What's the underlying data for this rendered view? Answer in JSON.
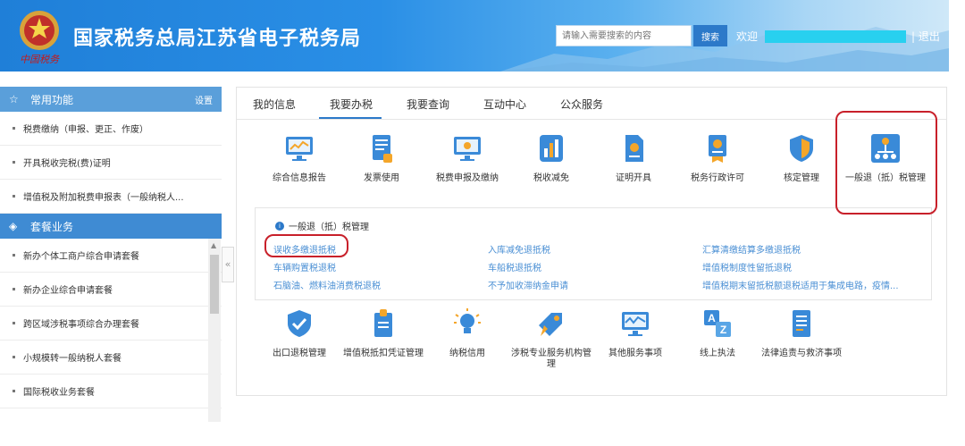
{
  "header": {
    "site_title": "国家税务总局江苏省电子税务局",
    "signature": "中国税务",
    "search_placeholder": "请输入需要搜索的内容",
    "search_label": "搜索",
    "welcome": "欢迎",
    "logout": "| 退出"
  },
  "sidebar": {
    "common_title": "常用功能",
    "settings": "设置",
    "common_items": [
      "税费缴纳（申报、更正、作废）",
      "开具税收完税(费)证明",
      "增值税及附加税费申报表（一般纳税人..."
    ],
    "package_title": "套餐业务",
    "package_items": [
      "新办个体工商户综合申请套餐",
      "新办企业综合申请套餐",
      "跨区域涉税事项综合办理套餐",
      "小规模转一般纳税人套餐",
      "国际税收业务套餐"
    ],
    "collapse": "«"
  },
  "tabs": [
    "我的信息",
    "我要办税",
    "我要查询",
    "互动中心",
    "公众服务"
  ],
  "tiles_row1": [
    {
      "label": "综合信息报告",
      "icon": "monitor-chart-icon"
    },
    {
      "label": "发票使用",
      "icon": "document-icon"
    },
    {
      "label": "税费申报及缴纳",
      "icon": "screen-icon"
    },
    {
      "label": "税收减免",
      "icon": "bar-chart-icon"
    },
    {
      "label": "证明开具",
      "icon": "certificate-icon"
    },
    {
      "label": "税务行政许可",
      "icon": "award-icon"
    },
    {
      "label": "核定管理",
      "icon": "shield-icon"
    },
    {
      "label": "一般退（抵）税管理",
      "icon": "person-network-icon"
    }
  ],
  "sub_panel": {
    "title": "一般退（抵）税管理",
    "links": [
      "误收多缴退抵税",
      "入库减免退抵税",
      "汇算清缴结算多缴退抵税",
      "车辆购置税退税",
      "车船税退抵税",
      "增值税制度性留抵退税",
      "石脑油、燃料油消费税退税",
      "不予加收滞纳金申请",
      "增值税期末留抵税额退税适用于集成电路，疫情..."
    ]
  },
  "tiles_row2": [
    {
      "label": "出口退税管理",
      "icon": "shield-check-icon"
    },
    {
      "label": "增值税抵扣凭证管理",
      "icon": "stamp-doc-icon"
    },
    {
      "label": "纳税信用",
      "icon": "bulb-icon"
    },
    {
      "label": "涉税专业服务机构管理",
      "icon": "tag-icon"
    },
    {
      "label": "其他服务事项",
      "icon": "monitor-line-icon"
    },
    {
      "label": "线上执法",
      "icon": "az-icon"
    },
    {
      "label": "法律追责与救济事项",
      "icon": "list-doc-icon"
    }
  ],
  "colors": {
    "accent": "#2c79c9",
    "link": "#4a8fd4",
    "highlight": "#c8202a"
  }
}
